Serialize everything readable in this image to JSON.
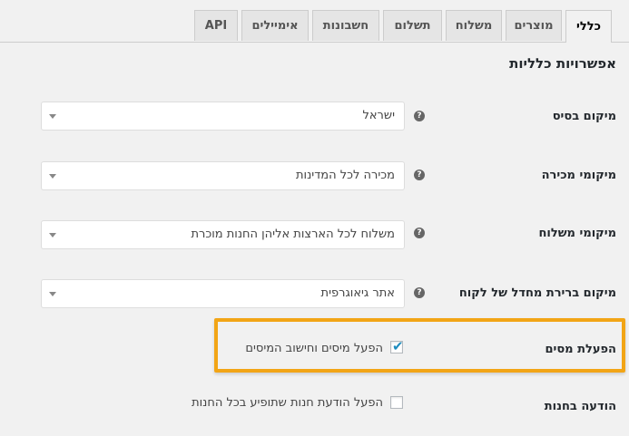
{
  "tabs": [
    {
      "label": "כללי",
      "active": true
    },
    {
      "label": "מוצרים"
    },
    {
      "label": "משלוח"
    },
    {
      "label": "תשלום"
    },
    {
      "label": "חשבונות"
    },
    {
      "label": "אימיילים"
    },
    {
      "label": "API"
    }
  ],
  "section_title": "אפשרויות כלליות",
  "settings": {
    "base_location": {
      "label": "מיקום בסיס",
      "value": "ישראל"
    },
    "selling_locations": {
      "label": "מיקומי מכירה",
      "value": "מכירה לכל המדינות"
    },
    "shipping_locations": {
      "label": "מיקומי משלוח",
      "value": "משלוח לכל הארצות אליהן החנות מוכרת"
    },
    "customer_default_location": {
      "label": "מיקום ברירת מחדל של לקוח",
      "value": "אתר גיאוגרפית"
    },
    "enable_taxes": {
      "label": "הפעלת מסים",
      "checkbox_label": "הפעל מיסים וחישוב המיסים",
      "checked": true
    },
    "store_notice": {
      "label": "הודעה בחנות",
      "checkbox_label": "הפעל הודעת חנות שתופיע בכל החנות",
      "checked": false
    }
  },
  "help_icon_glyph": "?",
  "check_glyph": "✔",
  "colors": {
    "highlight": "#f2a516",
    "check": "#1e8cbe"
  }
}
